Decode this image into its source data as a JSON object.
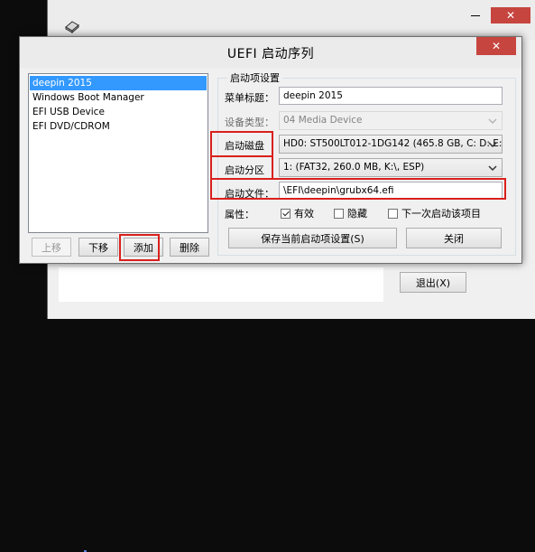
{
  "background_window": {
    "exit_button_label": "退出(X)",
    "close_glyph": "✕"
  },
  "dialog": {
    "title": "UEFI 启动序列",
    "close_glyph": "✕"
  },
  "entry_list": {
    "items": [
      {
        "label": "deepin 2015",
        "selected": true
      },
      {
        "label": "Windows Boot Manager",
        "selected": false
      },
      {
        "label": "EFI USB Device",
        "selected": false
      },
      {
        "label": "EFI DVD/CDROM",
        "selected": false
      }
    ]
  },
  "list_buttons": {
    "move_up": "上移",
    "move_down": "下移",
    "add": "添加",
    "delete": "删除"
  },
  "settings": {
    "group_title": "启动项设置",
    "menu_title_label": "菜单标题：",
    "menu_title_value": "deepin 2015",
    "device_type_label": "设备类型：",
    "device_type_value": "04 Media Device",
    "boot_disk_label": "启动磁盘",
    "boot_disk_value": "HD0: ST500LT012-1DG142 (465.8 GB, C: D: E:",
    "boot_partition_label": "启动分区",
    "boot_partition_value": "1: (FAT32, 260.0 MB, K:\\, ESP)",
    "boot_file_label": "启动文件：",
    "boot_file_value": "\\EFI\\deepin\\grubx64.efi",
    "attributes_label": "属性：",
    "attr_valid": {
      "label": "有效",
      "checked": true
    },
    "attr_hidden": {
      "label": "隐藏",
      "checked": false
    },
    "attr_next_boot": {
      "label": "下一次启动该项目",
      "checked": false
    },
    "save_button": "保存当前启动项设置(S)",
    "close_button": "关闭"
  },
  "colors": {
    "selection": "#3399ff",
    "annotation_red": "#d9201d",
    "close_red": "#c7453f"
  }
}
